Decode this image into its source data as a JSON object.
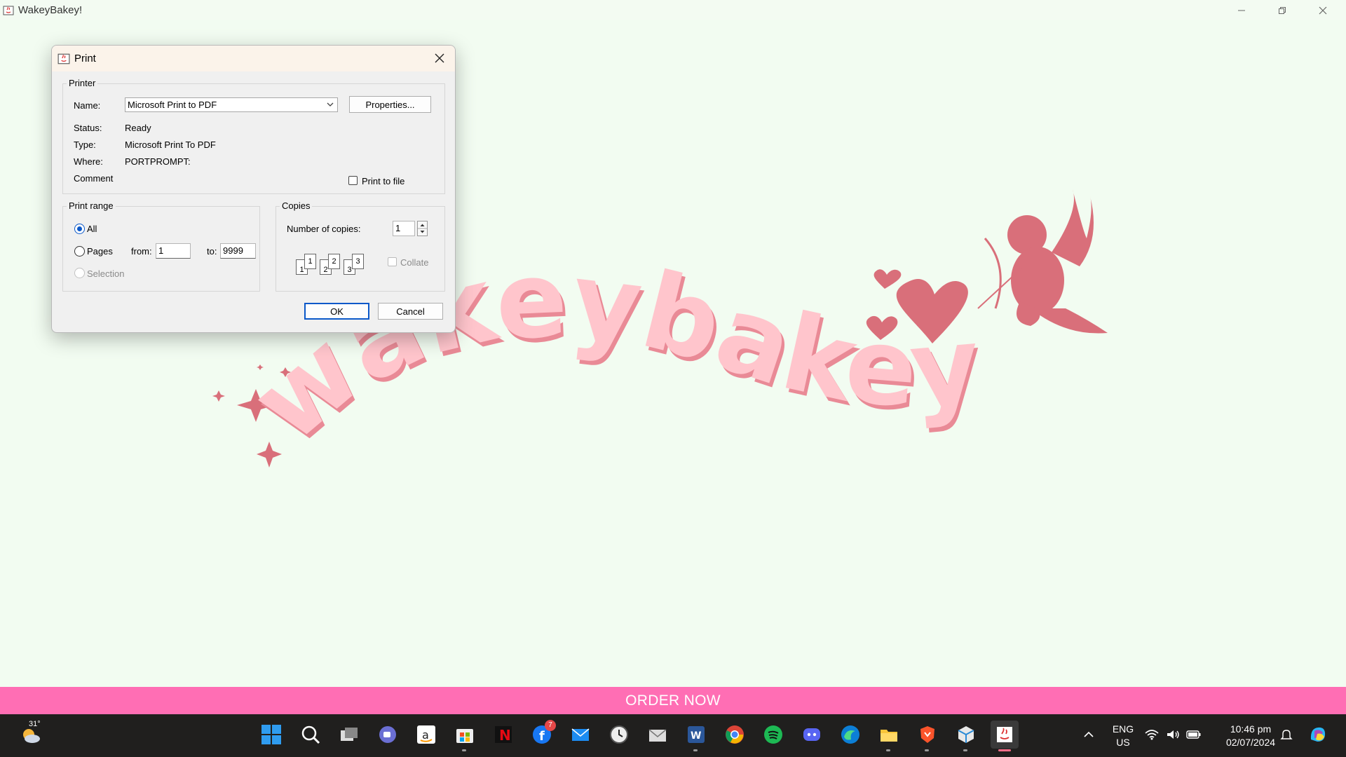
{
  "app": {
    "title": "WakeyBakey!",
    "logo_text": "wakeybakey",
    "order_button": "ORDER NOW",
    "colors": {
      "background": "#f2fcf1",
      "accent_pink": "#ff6eb4",
      "logo_pink": "#ffc5cc",
      "cupid_pink": "#d96f7a"
    }
  },
  "dialog": {
    "title": "Print",
    "printer": {
      "group_label": "Printer",
      "name_label": "Name:",
      "name_value": "Microsoft Print to PDF",
      "properties_button": "Properties...",
      "status_label": "Status:",
      "status_value": "Ready",
      "type_label": "Type:",
      "type_value": "Microsoft Print To PDF",
      "where_label": "Where:",
      "where_value": "PORTPROMPT:",
      "comment_label": "Comment",
      "print_to_file_label": "Print to file",
      "print_to_file_checked": false
    },
    "print_range": {
      "group_label": "Print range",
      "all_label": "All",
      "pages_label": "Pages",
      "from_label": "from:",
      "from_value": "1",
      "to_label": "to:",
      "to_value": "9999",
      "selection_label": "Selection",
      "selected": "All"
    },
    "copies": {
      "group_label": "Copies",
      "number_label": "Number of copies:",
      "number_value": "1",
      "collate_label": "Collate",
      "collate_checked": false,
      "collate_pages": [
        "1",
        "1",
        "2",
        "2",
        "3",
        "3"
      ]
    },
    "ok_button": "OK",
    "cancel_button": "Cancel"
  },
  "taskbar": {
    "weather": "31°",
    "facebook_badge": "7",
    "language_line1": "ENG",
    "language_line2": "US",
    "time": "10:46 pm",
    "date": "02/07/2024",
    "icons": [
      "weather-icon",
      "start-icon",
      "search-icon",
      "task-view-icon",
      "teams-icon",
      "amazon-icon",
      "store-icon",
      "netflix-icon",
      "facebook-icon",
      "mail-icon",
      "clock-icon",
      "email-icon",
      "word-icon",
      "chrome-icon",
      "spotify-icon",
      "discord-icon",
      "edge-icon",
      "file-explorer-icon",
      "brave-icon",
      "package-icon",
      "java-icon"
    ]
  }
}
